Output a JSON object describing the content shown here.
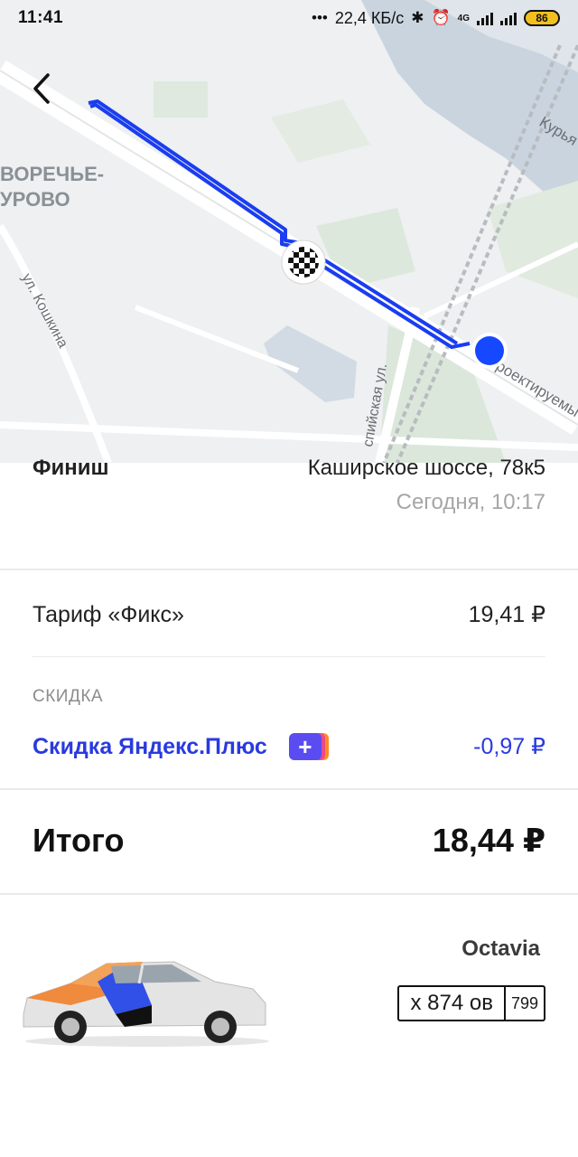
{
  "status_bar": {
    "time": "11:41",
    "network_speed": "22,4 КБ/с",
    "network_type": "4G",
    "battery": "86"
  },
  "map": {
    "labels": {
      "district_line1": "ВОРЕЧЬЕ-",
      "district_line2": "УРОВО",
      "street_koshkina": "ул. Кошкина",
      "street_kaspiyskaya": "спийская ул.",
      "street_proektiruemy": "роектируемы",
      "street_kurya": "Курья"
    },
    "icons": {
      "back": "chevron-left-icon",
      "finish": "checkered-flag-icon",
      "current_location": "location-dot-icon"
    },
    "colors": {
      "route": "#1a3df0",
      "location_dot": "#1648ff"
    }
  },
  "trip": {
    "finish_label": "Финиш",
    "finish_address": "Каширское шоссе, 78к5",
    "finish_time": "Сегодня, 10:17"
  },
  "pricing": {
    "tariff_label": "Тариф «Фикс»",
    "tariff_price": "19,41 ₽",
    "discount_header": "СКИДКА",
    "discount_label": "Скидка Яндекс.Плюс",
    "discount_icon": "yandex-plus-icon",
    "discount_value": "-0,97 ₽",
    "total_label": "Итого",
    "total_value": "18,44 ₽",
    "accent_color": "#2a3ae0"
  },
  "car": {
    "model": "Octavia",
    "plate_number": "х 874 ов",
    "plate_region": "799"
  }
}
